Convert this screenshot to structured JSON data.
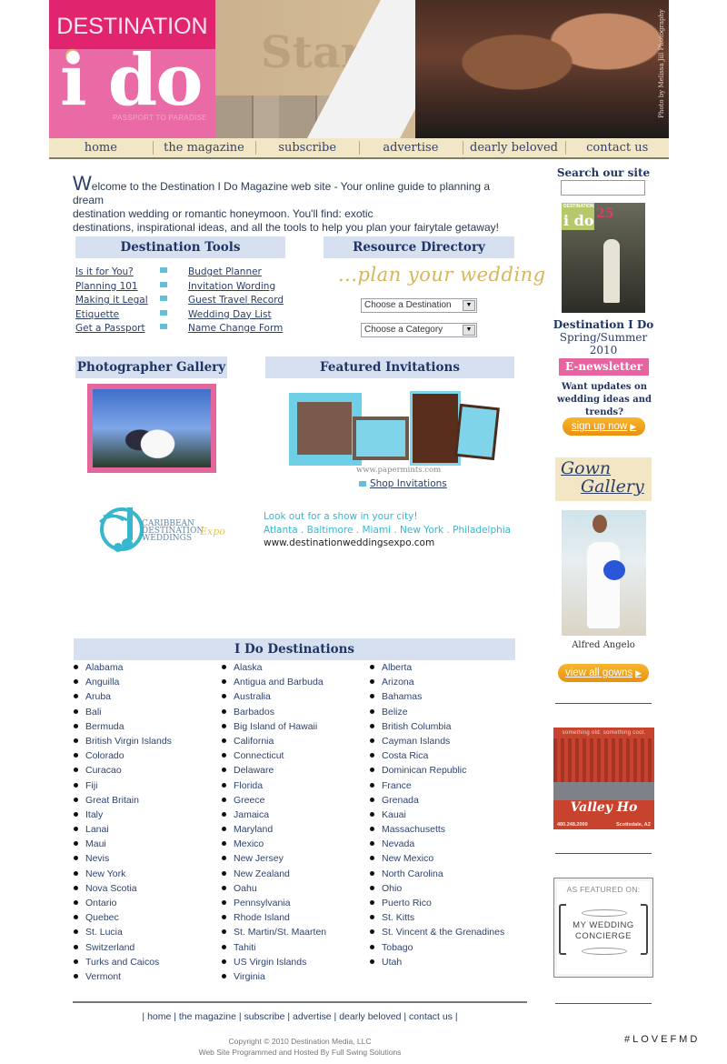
{
  "header": {
    "logo_top": "DESTINATION",
    "logo_main": "i do",
    "logo_tagline": "PASSPORT TO PARADISE",
    "hero_watermark": "Start",
    "hero_credit": "Photo by Melissa Jill Photography"
  },
  "nav": {
    "items": [
      "home",
      "the magazine",
      "subscribe",
      "advertise",
      "dearly beloved",
      "contact us"
    ]
  },
  "welcome": {
    "initial": "W",
    "line1": "elcome to the Destination I Do Magazine web site - Your online guide to planning a dream",
    "line2": "destination wedding or romantic honeymoon. You'll find: exotic",
    "line3": "destinations, inspirational ideas, and all the tools to help you plan your fairytale getaway!"
  },
  "destination_tools": {
    "title": "Destination Tools",
    "left_links": [
      "Is it for You?",
      "Planning 101",
      "Making it Legal",
      "Etiquette",
      "Get a Passport"
    ],
    "right_links": [
      "Budget Planner",
      "Invitation Wording",
      "Guest Travel Record",
      "Wedding Day List",
      "Name Change Form"
    ]
  },
  "resource_directory": {
    "title": "Resource Directory",
    "tagline": "...plan your wedding",
    "destination_select": "Choose a Destination",
    "category_select": "Choose a Category"
  },
  "photographer_gallery": {
    "title": "Photographer Gallery"
  },
  "featured_invitations": {
    "title": "Featured Invitations",
    "source_url": "www.papermints.com",
    "shop_link": "Shop Invitations"
  },
  "expo": {
    "logo_text": "CARIBBEAN DESTINATION WEDDINGS",
    "logo_script": "Expo",
    "line1": "Look out for a show in your city!",
    "line2": "Atlanta . Baltimore . Miami . New York . Philadelphia",
    "line3": "www.destinationweddingsexpo.com"
  },
  "destinations": {
    "title": "I Do Destinations",
    "columns": [
      [
        "Alabama",
        "Anguilla",
        "Aruba",
        "Bali",
        "Bermuda",
        "British Virgin Islands",
        "Colorado",
        "Curacao",
        "Fiji",
        "Great Britain",
        "Italy",
        "Lanai",
        "Maui",
        "Nevis",
        "New York",
        "Nova Scotia",
        "Ontario",
        "Quebec",
        "St. Lucia",
        "Switzerland",
        "Turks and Caicos",
        "Vermont"
      ],
      [
        "Alaska",
        "Antigua and Barbuda",
        "Australia",
        "Barbados",
        "Big Island of Hawaii",
        "California",
        "Connecticut",
        "Delaware",
        "Florida",
        "Greece",
        "Jamaica",
        "Maryland",
        "Mexico",
        "New Jersey",
        "New Zealand",
        "Oahu",
        "Pennsylvania",
        "Rhode Island",
        "St. Martin/St. Maarten",
        "Tahiti",
        "US Virgin Islands",
        "Virginia"
      ],
      [
        "Alberta",
        "Arizona",
        "Bahamas",
        "Belize",
        "British Columbia",
        "Cayman Islands",
        "Costa Rica",
        "Dominican Republic",
        "France",
        "Grenada",
        "Kauai",
        "Massachusetts",
        "Nevada",
        "New Mexico",
        "North Carolina",
        "Ohio",
        "Puerto Rico",
        "St. Kitts",
        "St. Vincent & the Grenadines",
        "Tobago",
        "Utah"
      ]
    ]
  },
  "sidebar": {
    "search_label": "Search our site",
    "search_value": "",
    "magazine_cover_logo": "i do",
    "magazine_cover_brand": "DESTINATION",
    "magazine_cover_number": "25",
    "magazine_title": "Destination I Do",
    "magazine_issue": "Spring/Summer 2010",
    "enewsletter_title": "E-newsletter",
    "enewsletter_question_1": "Want updates on",
    "enewsletter_question_2": "wedding ideas and trends?",
    "signup_button": "sign up now",
    "gown_gallery_1": "Gown",
    "gown_gallery_2": "Gallery",
    "gown_designer": "Alfred Angelo",
    "view_gowns_button": "view all gowns",
    "valley_ad_slogan": "something old. something cool.",
    "valley_ad_brand": "Valley Ho",
    "valley_ad_phone": "480.248.2000",
    "valley_ad_location": "Scottsdale, AZ",
    "featured_label": "AS FEATURED ON:",
    "featured_brand_1": "MY WEDDING",
    "featured_brand_2": "CONCIERGE"
  },
  "footer": {
    "links": [
      "home",
      "the magazine",
      "subscribe",
      "advertise",
      "dearly beloved",
      "contact us"
    ],
    "copyright": "Copyright © 2010 Destination Media, LLC",
    "hosted_by": "Web Site Programmed and Hosted By Full Swing Solutions",
    "watermark": "#LOVEFMD"
  },
  "colors": {
    "brand_pink": "#e0246e",
    "logo_pink": "#e96aa4",
    "nav_bg": "#f1e6c5",
    "heading_bg": "#d6e0f1",
    "heading_text": "#1f3566",
    "accent_teal": "#38b6cf",
    "button_orange": "#f0a11d"
  }
}
